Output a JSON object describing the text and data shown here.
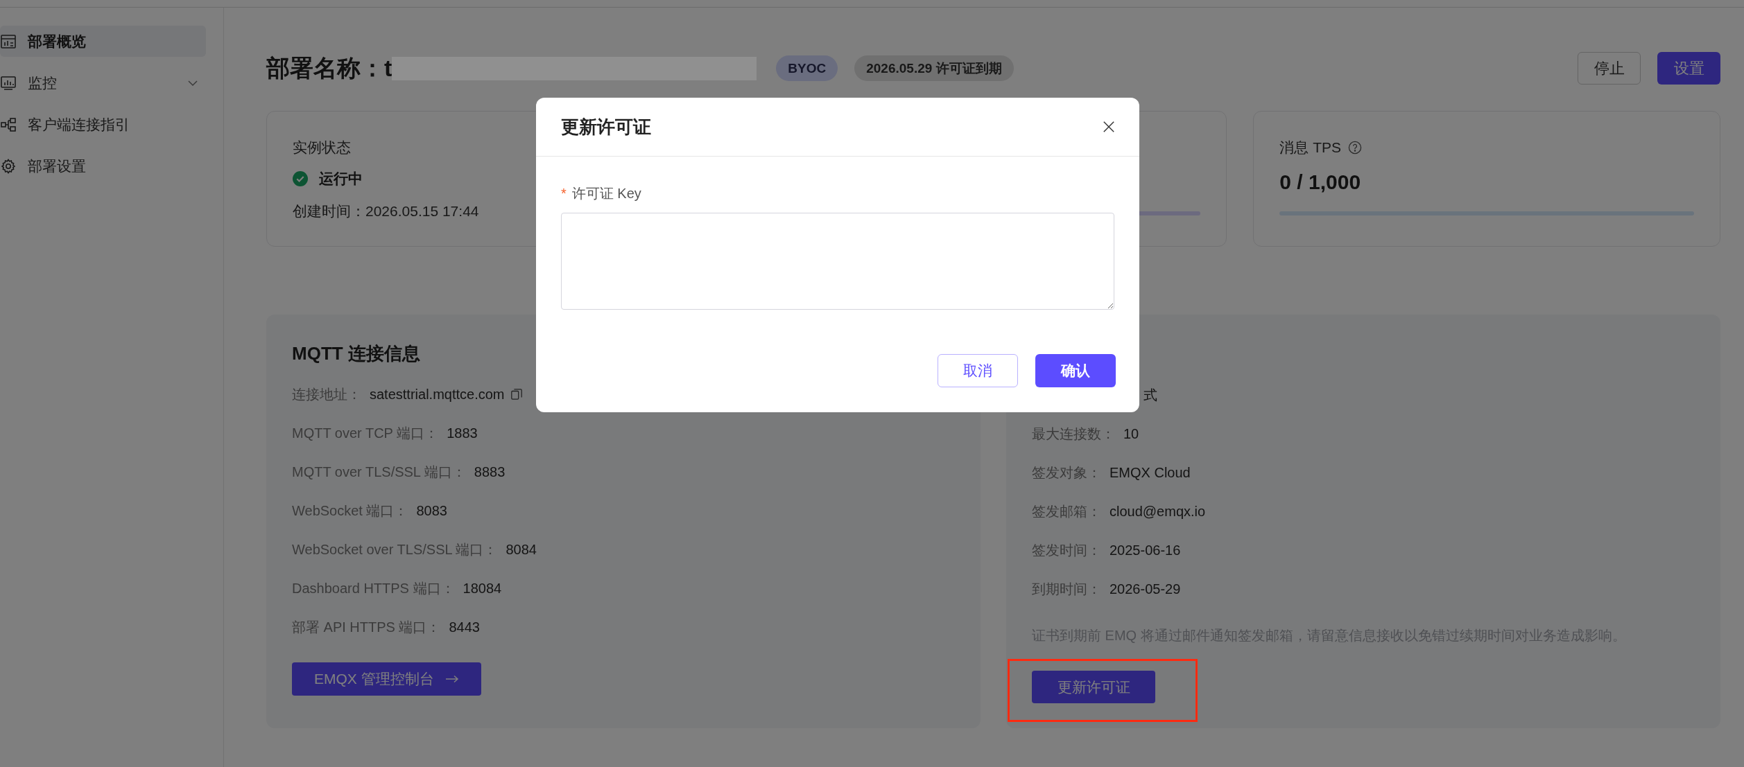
{
  "sidebar": {
    "items": [
      {
        "label": "部署概览",
        "selected": true,
        "kind": "link"
      },
      {
        "label": "监控",
        "selected": false,
        "kind": "group",
        "expanded": false
      },
      {
        "label": "客户端连接指引",
        "selected": false,
        "kind": "link"
      },
      {
        "label": "部署设置",
        "selected": false,
        "kind": "link"
      }
    ]
  },
  "header": {
    "title": "部署名称：t",
    "title_redacted": true,
    "badges": [
      {
        "text": "BYOC",
        "kind": "plan"
      },
      {
        "text": "2026.05.29 许可证到期",
        "kind": "expiry"
      }
    ],
    "buttons": [
      {
        "label": "停止",
        "kind": "secondary"
      },
      {
        "label": "设置",
        "kind": "primary"
      }
    ]
  },
  "metric_cards": [
    {
      "kind": "status",
      "title": "实例状态",
      "status": "运行中",
      "created": "创建时间：2026.05.15 17:44"
    },
    {
      "kind": "meter"
    },
    {
      "kind": "meter",
      "title": "消息 TPS",
      "value": "0 / 1,000",
      "level": 0
    }
  ],
  "connection_panel": {
    "title": "MQTT 连接信息",
    "rows": [
      {
        "label": "连接地址：",
        "value": "satesttrial.mqttce.com",
        "copyable": true
      },
      {
        "label": "MQTT over TCP 端口：",
        "value": "1883",
        "copyable": false
      },
      {
        "label": "MQTT over TLS/SSL 端口：",
        "value": "8883",
        "copyable": false
      },
      {
        "label": "WebSocket 端口：",
        "value": "8083",
        "copyable": false
      },
      {
        "label": "WebSocket over TLS/SSL 端口：",
        "value": "8084",
        "copyable": false
      },
      {
        "label": "Dashboard HTTPS 端口：",
        "value": "18084",
        "copyable": false
      },
      {
        "label": "部署 API HTTPS 端口：",
        "value": "8443",
        "copyable": false
      }
    ],
    "button": "EMQX 管理控制台"
  },
  "license_panel": {
    "covered_row_value": "式",
    "rows": [
      {
        "label": "最大连接数：",
        "value": "10"
      },
      {
        "label": "签发对象：",
        "value": "EMQX Cloud"
      },
      {
        "label": "签发邮箱：",
        "value": "cloud@emqx.io"
      },
      {
        "label": "签发时间：",
        "value": "2025-06-16"
      },
      {
        "label": "到期时间：",
        "value": "2026-05-29"
      }
    ],
    "note": "证书到期前 EMQ 将通过邮件通知签发邮箱，请留意信息接收以免错过续期时间对业务造成影响。",
    "button": {
      "label": "更新许可证",
      "highlighted": true
    }
  },
  "dialog": {
    "title": "更新许可证",
    "field": {
      "label": "许可证 Key",
      "required_mark": "*"
    },
    "buttons": [
      {
        "label": "取消",
        "kind": "secondary"
      },
      {
        "label": "确认",
        "kind": "primary"
      }
    ]
  }
}
